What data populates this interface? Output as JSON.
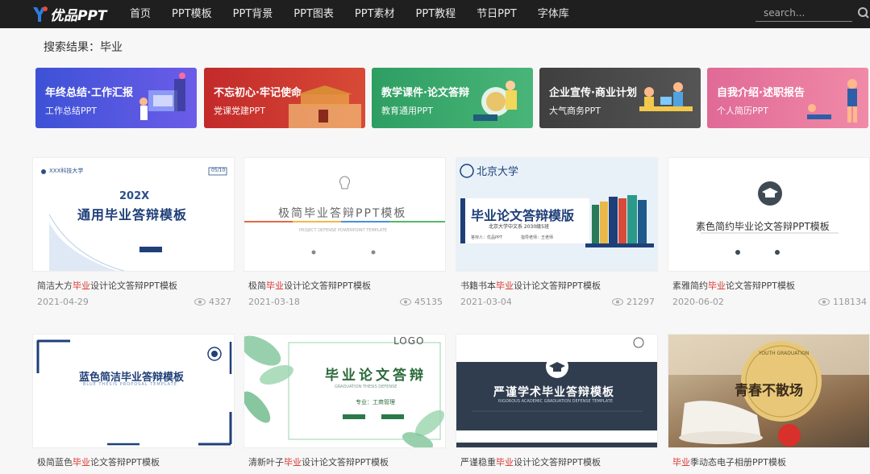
{
  "header": {
    "logo_text": "优品PPT",
    "nav": [
      "首页",
      "PPT模板",
      "PPT背景",
      "PPT图表",
      "PPT素材",
      "PPT教程",
      "节日PPT",
      "字体库"
    ],
    "search_placeholder": "search...",
    "search_icon": "search-icon"
  },
  "result": {
    "label": "搜索结果：毕业"
  },
  "categories": [
    {
      "title": "年终总结·工作汇报",
      "sub": "工作总结PPT",
      "color": "#4a5fd8"
    },
    {
      "title": "不忘初心·牢记使命",
      "sub": "党课党建PPT",
      "color": "#c9302c"
    },
    {
      "title": "教学课件·论文答辩",
      "sub": "教育通用PPT",
      "color": "#3aa56a"
    },
    {
      "title": "企业宣传·商业计划",
      "sub": "大气商务PPT",
      "color": "#4a4a4a"
    },
    {
      "title": "自我介绍·述职报告",
      "sub": "个人简历PPT",
      "color": "#e87a9a"
    }
  ],
  "cards": [
    {
      "pre": "简洁大方",
      "hl": "毕业",
      "post": "设计论文答辩PPT模板",
      "date": "2021-04-29",
      "views": "4327",
      "thumb": {
        "school": "XXX科技大学",
        "page": "05/10",
        "big": "202X",
        "title": "通用毕业答辩模板"
      }
    },
    {
      "pre": "极简",
      "hl": "毕业",
      "post": "设计论文答辩PPT模板",
      "date": "2021-03-18",
      "views": "45135",
      "thumb": {
        "title": "极简毕业答辩PPT模板",
        "sub": "PROJECT DEFENSE POWERPOINT TEMPLATE"
      }
    },
    {
      "pre": "书籍书本",
      "hl": "毕业",
      "post": "设计论文答辩PPT模板",
      "date": "2021-03-04",
      "views": "21297",
      "thumb": {
        "school": "北京大学",
        "title": "毕业论文答辩模版",
        "sub": "北京大学中文系 2030级5班",
        "info1": "答辩人：优品PPT",
        "info2": "指导老师：王老师"
      }
    },
    {
      "pre": "素雅简约",
      "hl": "毕业",
      "post": "论文答辩PPT模板",
      "date": "2020-06-02",
      "views": "118134",
      "thumb": {
        "title": "素色简约毕业论文答辩PPT模板"
      }
    },
    {
      "pre": "极简蓝色",
      "hl": "毕业",
      "post": "论文答辩PPT模板",
      "date": "",
      "views": "",
      "thumb": {
        "title": "蓝色简洁毕业答辩模板",
        "sub": "BLUE THESIS PROPOSAL TEMPLATE"
      }
    },
    {
      "pre": "清新叶子",
      "hl": "毕业",
      "post": "设计论文答辩PPT模板",
      "date": "",
      "views": "",
      "thumb": {
        "logo": "LOGO",
        "title": "毕业论文答辩",
        "sub": "GRADUATION THESIS DEFENSE",
        "major": "专业：工商管理"
      }
    },
    {
      "pre": "严谨稳重",
      "hl": "毕业",
      "post": "设计论文答辩PPT模板",
      "date": "",
      "views": "",
      "thumb": {
        "title": "严谨学术毕业答辩模板",
        "sub": "RIGOROUS ACADEMIC GRADUATION DEFENSE TEMPLATE"
      }
    },
    {
      "pre": "",
      "hl": "毕业",
      "post": "季动态电子相册PPT模板",
      "date": "",
      "views": "",
      "thumb": {
        "title": "青春不散场",
        "ring": "YOUTH GRADUATION"
      }
    }
  ]
}
